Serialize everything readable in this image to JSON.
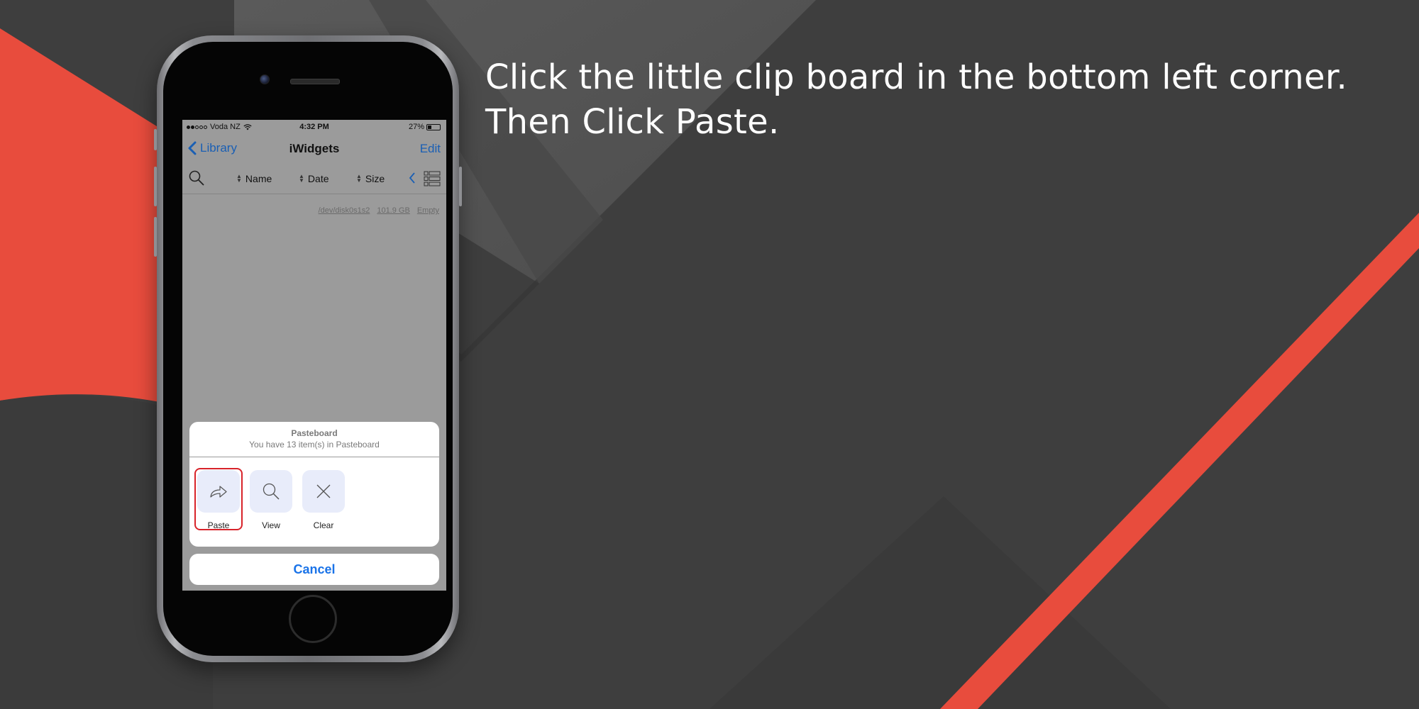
{
  "instruction": {
    "line1": "Click the little clip board in the bottom left corner.",
    "line2": "Then Click Paste."
  },
  "colors": {
    "background": "#3d3d3d",
    "accent_red": "#e84c3d",
    "ios_blue": "#1a73e8",
    "highlight_red": "#d8232a"
  },
  "status_bar": {
    "carrier": "Voda NZ",
    "time": "4:32 PM",
    "battery": "27%",
    "signal_icon": "signal-dots-icon",
    "wifi_icon": "wifi-icon",
    "battery_icon": "battery-icon"
  },
  "nav": {
    "back_label": "Library",
    "title": "iWidgets",
    "edit_label": "Edit"
  },
  "toolbar": {
    "search_icon": "search-icon",
    "sort_name": "Name",
    "sort_date": "Date",
    "sort_size": "Size",
    "list_icon": "list-view-icon"
  },
  "disk_info": {
    "device": "/dev/disk0s1s2",
    "capacity": "101.9 GB",
    "status": "Empty"
  },
  "pasteboard": {
    "title": "Pasteboard",
    "subtitle": "You have 13 item(s) in Pasteboard",
    "actions": [
      {
        "label": "Paste",
        "icon": "paste-arrow-icon"
      },
      {
        "label": "View",
        "icon": "search-icon"
      },
      {
        "label": "Clear",
        "icon": "close-icon"
      }
    ],
    "cancel_label": "Cancel"
  }
}
